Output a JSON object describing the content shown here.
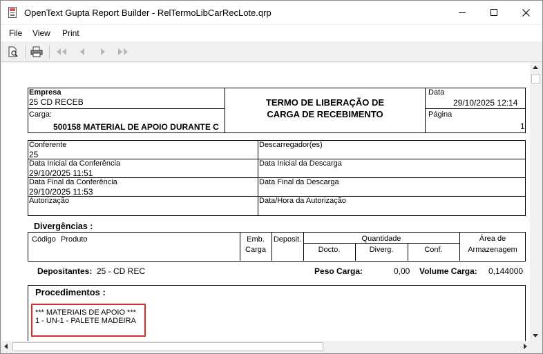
{
  "window": {
    "title": "OpenText Gupta Report Builder - RelTermoLibCarRecLote.qrp"
  },
  "menu": {
    "items": [
      "File",
      "View",
      "Print"
    ]
  },
  "toolbar": {
    "buttons": [
      "preview-icon",
      "print-icon",
      "first-page-icon",
      "previous-page-icon",
      "next-page-icon",
      "last-page-icon"
    ]
  },
  "report": {
    "header": {
      "empresa_label": "Empresa",
      "empresa_value": "25 CD RECEB",
      "carga_label": "Carga:",
      "carga_value": "500158 MATERIAL DE APOIO DURANTE C",
      "title_line1": "TERMO DE LIBERAÇÃO DE",
      "title_line2": "CARGA DE RECEBIMENTO",
      "data_label": "Data",
      "data_value": "29/10/2025   12:14",
      "pagina_label": "Página",
      "pagina_value": "1"
    },
    "info": {
      "conferente_label": "Conferente",
      "conferente_value": "25",
      "descarregador_label": "Descarregador(es)",
      "data_ini_conf_label": "Data Inicial da Conferência",
      "data_ini_conf_value": "29/10/2025 11:51",
      "data_ini_desc_label": "Data Inicial da Descarga",
      "data_fin_conf_label": "Data Final da Conferência",
      "data_fin_conf_value": "29/10/2025 11:53",
      "data_fin_desc_label": "Data Final da Descarga",
      "autorizacao_label": "Autorização",
      "data_hora_aut_label": "Data/Hora da Autorização"
    },
    "divergencias": {
      "title": "Divergências :",
      "col_codigo": "Código",
      "col_produto": "Produto",
      "col_emb1": "Emb.",
      "col_emb2": "Carga",
      "col_deposit": "Deposit.",
      "col_quantidade": "Quantidade",
      "col_docto": "Docto.",
      "col_diverg": "Diverg.",
      "col_conf": "Conf.",
      "col_area1": "Área de",
      "col_area2": "Armazenagem"
    },
    "summary": {
      "depositantes_label": "Depositantes:",
      "depositantes_value": "25 - CD REC",
      "peso_label": "Peso Carga:",
      "peso_value": "0,00",
      "volume_label": "Volume Carga:",
      "volume_value": "0,144000"
    },
    "procedimentos": {
      "title": "Procedimentos :",
      "line1": "*** MATERIAIS DE APOIO ***",
      "line2": "1 - UN-1 - PALETE MADEIRA"
    }
  }
}
